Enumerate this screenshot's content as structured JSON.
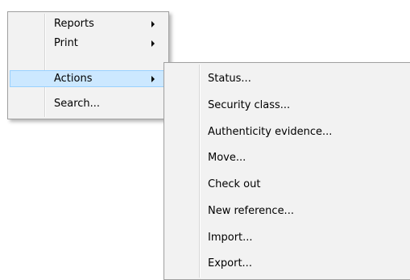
{
  "main_menu": {
    "items": [
      {
        "label": "Reports",
        "has_submenu": true
      },
      {
        "label": "Print",
        "has_submenu": true
      },
      {
        "label": "Actions",
        "has_submenu": true,
        "highlighted": true
      },
      {
        "label": "Search...",
        "has_submenu": false
      }
    ]
  },
  "actions_submenu": {
    "items": [
      {
        "label": "Status..."
      },
      {
        "label": "Security class..."
      },
      {
        "label": "Authenticity evidence..."
      },
      {
        "label": "Move..."
      },
      {
        "label": "Check out"
      },
      {
        "label": "New reference..."
      },
      {
        "label": "Import..."
      },
      {
        "label": "Export..."
      }
    ]
  },
  "colors": {
    "menu_background": "#f2f2f2",
    "highlight_background": "#cce8ff",
    "highlight_border": "#99d1ff",
    "menu_border": "#a0a0a0"
  },
  "icons": {
    "submenu_arrow": "chevron-right-icon"
  }
}
